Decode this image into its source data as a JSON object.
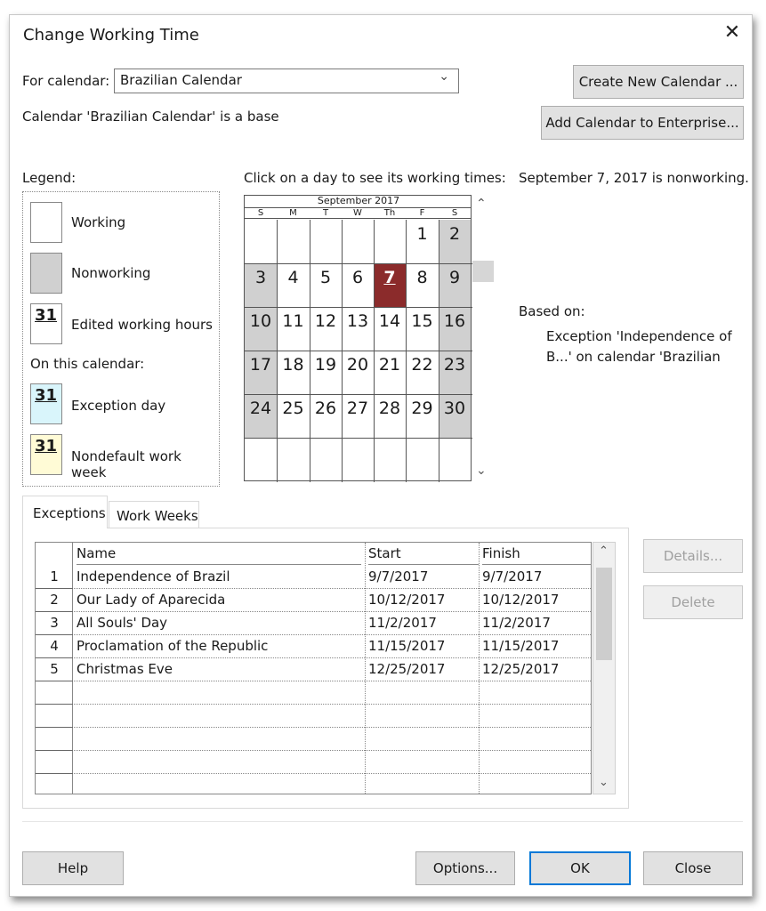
{
  "dialog": {
    "title": "Change Working Time",
    "close_label": "✕"
  },
  "calendar_selector": {
    "label": "For calendar:",
    "selected": "Brazilian Calendar",
    "info": "Calendar 'Brazilian Calendar' is a base"
  },
  "buttons": {
    "create_new_calendar": "Create New Calendar ...",
    "add_to_enterprise": "Add Calendar to Enterprise...",
    "details": "Details...",
    "delete": "Delete",
    "help": "Help",
    "options": "Options...",
    "ok": "OK",
    "close": "Close"
  },
  "legend": {
    "heading": "Legend:",
    "working": "Working",
    "nonworking": "Nonworking",
    "edited_hours": "Edited working hours",
    "on_this_calendar": "On this calendar:",
    "exception_day": "Exception day",
    "nondefault_week": "Nondefault work week",
    "swatch_number": "31",
    "colors": {
      "working": "#ffffff",
      "nonworking": "#d0d0d0",
      "exception": "#d9f5fb",
      "nondefault": "#fffbd6"
    }
  },
  "calendar_view": {
    "instruction": "Click on a day to see its working times:",
    "month_label": "September 2017",
    "weekdays": [
      "S",
      "M",
      "T",
      "W",
      "Th",
      "F",
      "S"
    ],
    "weeks": [
      [
        "",
        "",
        "",
        "",
        "",
        "1",
        "2"
      ],
      [
        "3",
        "4",
        "5",
        "6",
        "7",
        "8",
        "9"
      ],
      [
        "10",
        "11",
        "12",
        "13",
        "14",
        "15",
        "16"
      ],
      [
        "17",
        "18",
        "19",
        "20",
        "21",
        "22",
        "23"
      ],
      [
        "24",
        "25",
        "26",
        "27",
        "28",
        "29",
        "30"
      ],
      [
        "",
        "",
        "",
        "",
        "",
        "",
        ""
      ]
    ],
    "selected_day": "7",
    "selected_color": "#8b2b2b"
  },
  "day_info": {
    "status": "September 7, 2017 is nonworking.",
    "based_on_label": "Based on:",
    "based_on_line1": "Exception 'Independence of",
    "based_on_line2": "B...' on calendar 'Brazilian"
  },
  "tabs": {
    "exceptions": "Exceptions",
    "work_weeks": "Work Weeks"
  },
  "exceptions_table": {
    "columns": [
      "Name",
      "Start",
      "Finish"
    ],
    "rows": [
      {
        "num": "1",
        "name": "Independence of Brazil",
        "start": "9/7/2017",
        "finish": "9/7/2017"
      },
      {
        "num": "2",
        "name": "Our Lady of Aparecida",
        "start": "10/12/2017",
        "finish": "10/12/2017"
      },
      {
        "num": "3",
        "name": "All Souls' Day",
        "start": "11/2/2017",
        "finish": "11/2/2017"
      },
      {
        "num": "4",
        "name": "Proclamation of the Republic",
        "start": "11/15/2017",
        "finish": "11/15/2017"
      },
      {
        "num": "5",
        "name": "Christmas Eve",
        "start": "12/25/2017",
        "finish": "12/25/2017"
      }
    ]
  }
}
